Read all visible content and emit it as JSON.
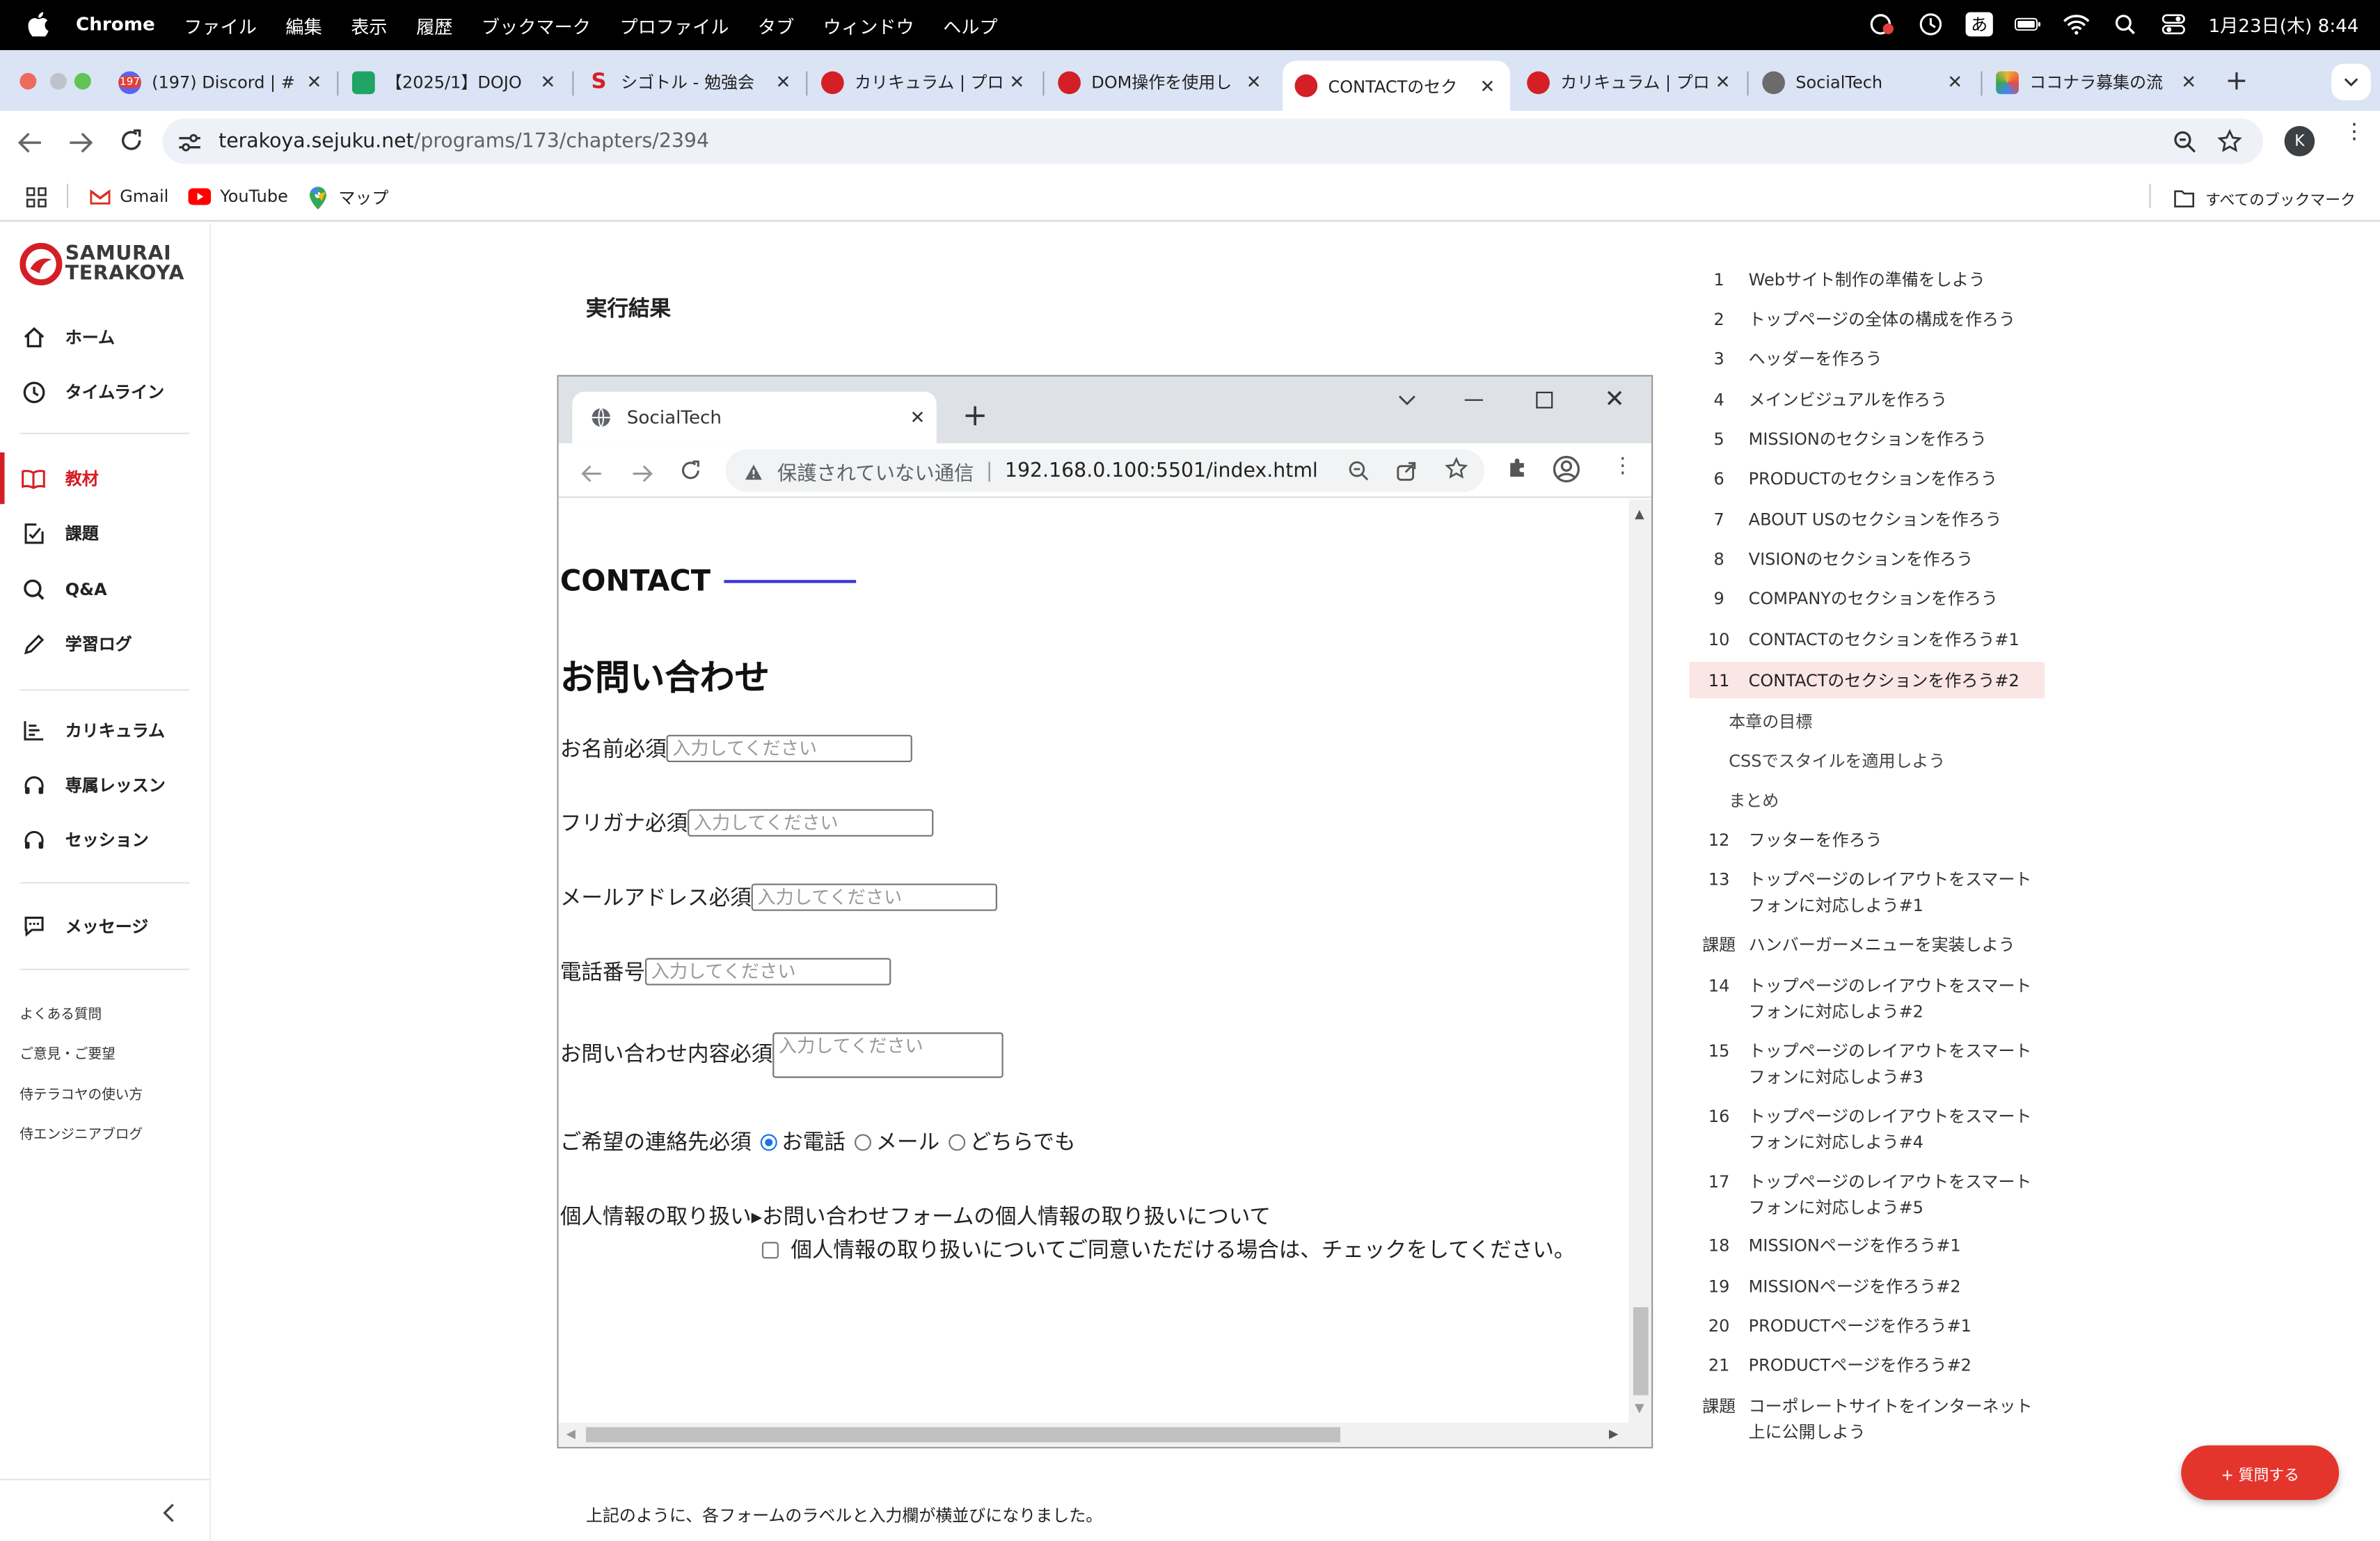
{
  "menubar": {
    "app": "Chrome",
    "menus": [
      "ファイル",
      "編集",
      "表示",
      "履歴",
      "ブックマーク",
      "プロファイル",
      "タブ",
      "ウィンドウ",
      "ヘルプ"
    ],
    "ime": "あ",
    "datetime": "1月23日(木) 8:44"
  },
  "tabs": [
    {
      "title": "(197) Discord | #",
      "badge": "197",
      "color": "#5865f2"
    },
    {
      "title": "【2025/1】DOJO",
      "color": "#1fa463"
    },
    {
      "title": "シゴトル - 勉強会",
      "color": "#d41f26"
    },
    {
      "title": "カリキュラム | プロ",
      "color": "#d41f26"
    },
    {
      "title": "DOM操作を使用し",
      "color": "#d41f26"
    },
    {
      "title": "CONTACTのセク",
      "color": "#d41f26",
      "active": true
    },
    {
      "title": "カリキュラム | プロ",
      "color": "#d41f26"
    },
    {
      "title": "SocialTech",
      "color": "#6b6b6b"
    },
    {
      "title": "ココナラ募集の流",
      "color": "#f2b233"
    }
  ],
  "address": {
    "host": "terakoya.sejuku.net",
    "path": "/programs/173/chapters/2394",
    "avatar": "K"
  },
  "bookmarks": [
    {
      "label": "Gmail",
      "icon": "gmail-icon"
    },
    {
      "label": "YouTube",
      "icon": "youtube-icon"
    },
    {
      "label": "マップ",
      "icon": "maps-icon"
    }
  ],
  "bookmarks_all": "すべてのブックマーク",
  "brand": {
    "line1": "SAMURAI",
    "line2": "TERAKOYA"
  },
  "sidebar": {
    "nav": [
      {
        "label": "ホーム",
        "icon": "home-icon"
      },
      {
        "label": "タイムライン",
        "icon": "clock-icon"
      },
      {
        "label": "教材",
        "icon": "book-icon",
        "active": true
      },
      {
        "label": "課題",
        "icon": "task-icon"
      },
      {
        "label": "Q&A",
        "icon": "search-icon"
      },
      {
        "label": "学習ログ",
        "icon": "pencil-icon"
      },
      {
        "label": "カリキュラム",
        "icon": "chart-icon"
      },
      {
        "label": "専属レッスン",
        "icon": "headset-icon"
      },
      {
        "label": "セッション",
        "icon": "headset-icon"
      },
      {
        "label": "メッセージ",
        "icon": "chat-icon"
      }
    ],
    "links": [
      "よくある質問",
      "ご意見・ご要望",
      "侍テラコヤの使い方",
      "侍エンジニアブログ"
    ]
  },
  "main": {
    "title": "実行結果",
    "bottom_text": "上記のように、各フォームのラベルと入力欄が横並びになりました。"
  },
  "screenshot": {
    "tab_title": "SocialTech",
    "insecure": "保護されていない通信",
    "url": "192.168.0.100:5501/index.html",
    "section": "CONTACT",
    "heading": "お問い合わせ",
    "placeholder": "入力してください",
    "fields": [
      {
        "label": "お名前",
        "req": "必須"
      },
      {
        "label": "フリガナ",
        "req": "必須"
      },
      {
        "label": "メールアドレス",
        "req": "必須"
      },
      {
        "label": "電話番号",
        "req": ""
      },
      {
        "label": "お問い合わせ内容",
        "req": "必須"
      }
    ],
    "contact_label": "ご希望の連絡先",
    "contact_req": "必須",
    "contact_options": [
      "お電話",
      "メール",
      "どちらでも"
    ],
    "privacy_label": "個人情報の取り扱い",
    "privacy_summary": "▸お問い合わせフォームの個人情報の取り扱いについて",
    "privacy_check": "個人情報の取り扱いについてご同意いただける場合は、チェックをしてください。"
  },
  "curriculum": [
    {
      "num": "1",
      "label": "Webサイト制作の準備をしよう"
    },
    {
      "num": "2",
      "label": "トップページの全体の構成を作ろう"
    },
    {
      "num": "3",
      "label": "ヘッダーを作ろう"
    },
    {
      "num": "4",
      "label": "メインビジュアルを作ろう"
    },
    {
      "num": "5",
      "label": "MISSIONのセクションを作ろう"
    },
    {
      "num": "6",
      "label": "PRODUCTのセクションを作ろう"
    },
    {
      "num": "7",
      "label": "ABOUT USのセクションを作ろう"
    },
    {
      "num": "8",
      "label": "VISIONのセクションを作ろう"
    },
    {
      "num": "9",
      "label": "COMPANYのセクションを作ろう"
    },
    {
      "num": "10",
      "label": "CONTACTのセクションを作ろう#1"
    },
    {
      "num": "11",
      "label": "CONTACTのセクションを作ろう#2",
      "active": true
    },
    {
      "num": "12",
      "label": "フッターを作ろう"
    },
    {
      "num": "13",
      "label": "トップページのレイアウトをスマートフォンに対応しよう#1"
    },
    {
      "num": "課題",
      "label": "ハンバーガーメニューを実装しよう"
    },
    {
      "num": "14",
      "label": "トップページのレイアウトをスマートフォンに対応しよう#2"
    },
    {
      "num": "15",
      "label": "トップページのレイアウトをスマートフォンに対応しよう#3"
    },
    {
      "num": "16",
      "label": "トップページのレイアウトをスマートフォンに対応しよう#4"
    },
    {
      "num": "17",
      "label": "トップページのレイアウトをスマートフォンに対応しよう#5"
    },
    {
      "num": "18",
      "label": "MISSIONページを作ろう#1"
    },
    {
      "num": "19",
      "label": "MISSIONページを作ろう#2"
    },
    {
      "num": "20",
      "label": "PRODUCTページを作ろう#1"
    },
    {
      "num": "21",
      "label": "PRODUCTページを作ろう#2"
    },
    {
      "num": "課題",
      "label": "コーポレートサイトをインターネット上に公開しよう"
    }
  ],
  "chapter_subs": [
    "本章の目標",
    "CSSでスタイルを適用しよう",
    "まとめ"
  ],
  "ask_button": "+ 質問する",
  "colors": {
    "accent": "#d41f26",
    "active_bg": "#fbe6e6",
    "link_blue": "#3b33d6"
  }
}
